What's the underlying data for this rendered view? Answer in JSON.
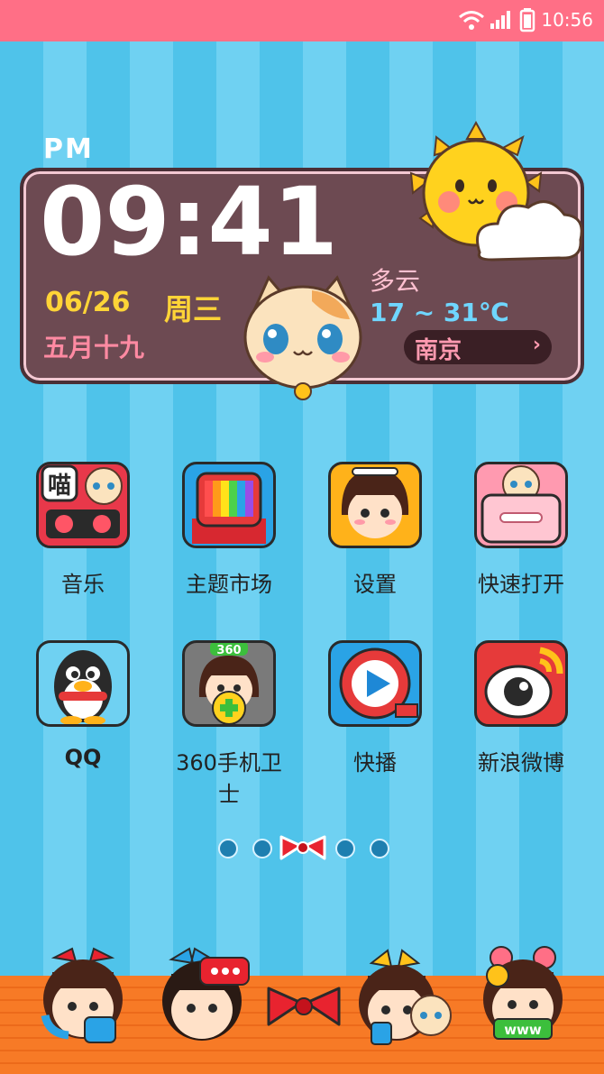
{
  "status_bar": {
    "time": "10:56",
    "icons": [
      "wifi-icon",
      "signal-icon",
      "battery-icon"
    ]
  },
  "widget": {
    "ampm": "PM",
    "time": "09:41",
    "date": "06/26",
    "weekday": "周三",
    "lunar_date": "五月十九",
    "weather": "多云",
    "temperature": "17 ~ 31℃",
    "city": "南京"
  },
  "apps": [
    {
      "label": "音乐",
      "icon": "music-cassette-icon"
    },
    {
      "label": "主题市场",
      "icon": "theme-tv-icon"
    },
    {
      "label": "设置",
      "icon": "settings-girl-icon"
    },
    {
      "label": "快速打开",
      "icon": "quick-open-cat-icon"
    },
    {
      "label": "QQ",
      "icon": "qq-penguin-icon"
    },
    {
      "label": "360手机卫士",
      "icon": "security-360-icon"
    },
    {
      "label": "快播",
      "icon": "qvod-play-icon"
    },
    {
      "label": "新浪微博",
      "icon": "weibo-eye-icon"
    }
  ],
  "icon_badges": {
    "music": "喵",
    "security": "360",
    "browser": "www"
  },
  "page_indicator": {
    "pages": 5,
    "current": 3
  },
  "dock": [
    {
      "icon": "phone-girl-icon"
    },
    {
      "icon": "messages-girl-icon"
    },
    {
      "icon": "app-drawer-bow-icon"
    },
    {
      "icon": "contacts-girl-icon"
    },
    {
      "icon": "browser-girl-icon"
    }
  ],
  "colors": {
    "status_bar": "#ff6f86",
    "stripe_dark": "#4fc3ea",
    "stripe_light": "#6fd1f2",
    "dock_wood": "#f77a26",
    "clock_text": "#ffffff",
    "date_text": "#ffd437"
  }
}
